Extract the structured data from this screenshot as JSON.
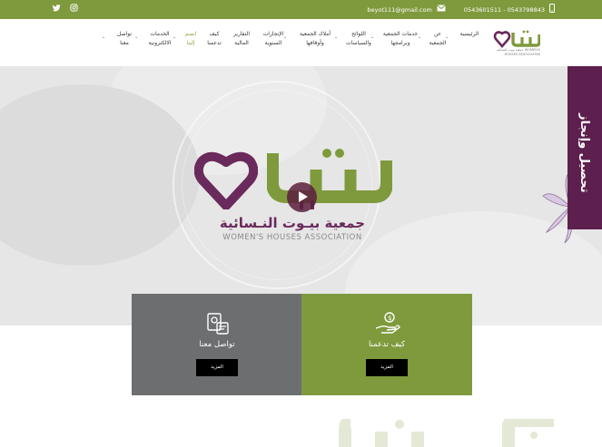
{
  "topbar": {
    "email": "beyot111@gmail.com",
    "phones": "0543601511 - 0543798843",
    "social": [
      "twitter-icon",
      "instagram-icon"
    ]
  },
  "brand": {
    "logo_word": "بيوت",
    "logo_sub": "جمعية بيوت النسائية WOMEN'S HOUSES ASSOCIATION"
  },
  "nav": {
    "items": [
      {
        "line1": "الرئيسية",
        "line2": "",
        "chevron": true
      },
      {
        "line1": "عن",
        "line2": "الجمعية",
        "chevron": true
      },
      {
        "line1": "خدمات الجمعية",
        "line2": "وبرامجها",
        "chevron": true
      },
      {
        "line1": "اللوائح",
        "line2": "والسياسات",
        "chevron": true
      },
      {
        "line1": "أملاك الجمعية",
        "line2": "وأوقافها",
        "chevron": true
      },
      {
        "line1": "الإنجازات",
        "line2": "السنوية",
        "chevron": false
      },
      {
        "line1": "التقارير",
        "line2": "المالية",
        "chevron": false
      },
      {
        "line1": "كيف",
        "line2": "تدعمنا",
        "chevron": false
      },
      {
        "line1": "انضم",
        "line2": "إلينا",
        "chevron": true,
        "active": true
      },
      {
        "line1": "الخدمات",
        "line2": "الالكترونية",
        "chevron": true
      },
      {
        "line1": "تواصل",
        "line2": "معنا",
        "chevron": true
      }
    ]
  },
  "hero": {
    "ribbon_text": "تحصيل وإنجاز",
    "org_name_ar": "جمعية بيـوت النـسائية",
    "org_name_en": "WOMEN'S HOUSES ASSOCIATION"
  },
  "cards": [
    {
      "title": "تواصل معنا",
      "button": "المزيد",
      "icon": "contact-icon"
    },
    {
      "title": "كيف تدعمنا",
      "button": "المزيد",
      "icon": "donate-hand-icon"
    }
  ],
  "colors": {
    "green": "#7f9a3d",
    "purple": "#5d1f4d",
    "grey": "#6d6e70"
  }
}
